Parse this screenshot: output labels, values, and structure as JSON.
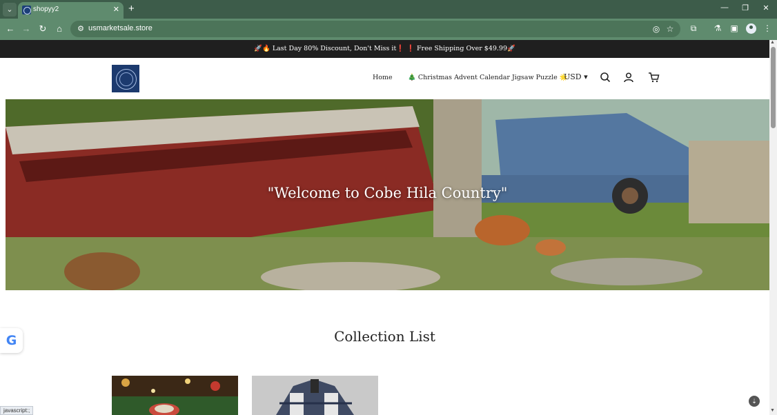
{
  "browser": {
    "tab_title": "shopyy2",
    "new_tab_symbol": "+",
    "url": "usmarketsale.store",
    "status_text": "javascript:;"
  },
  "announcement": {
    "text": "🚀🔥 Last Day 80% Discount, Don't Miss it❗ ❗ Free Shipping Over $49.99🚀"
  },
  "header": {
    "nav": [
      {
        "label": "Home"
      },
      {
        "label": "🎄 Christmas Advent Calendar Jigsaw Puzzle 🌟"
      }
    ],
    "currency": "USD"
  },
  "hero": {
    "title": "\"Welcome to Cobe Hila Country\""
  },
  "collection": {
    "title": "Collection List"
  },
  "icons": {
    "tab_menu": "chevron-down-icon",
    "back": "arrow-left-icon",
    "forward": "arrow-right-icon",
    "reload": "reload-icon",
    "home": "home-icon",
    "site_info": "tune-icon",
    "eye_off": "eye-off-icon",
    "bookmark": "star-icon",
    "extensions": "puzzle-icon",
    "labs": "flask-icon",
    "sidebar": "sidebar-icon",
    "menu": "kebab-icon",
    "search": "search-icon",
    "account": "user-icon",
    "cart": "cart-icon"
  },
  "colors": {
    "browser_frame": "#3d5c4a",
    "browser_toolbar": "#5f8b6e",
    "announcement_bg": "#1f1f1f",
    "logo_bg": "#1c3a6e"
  }
}
